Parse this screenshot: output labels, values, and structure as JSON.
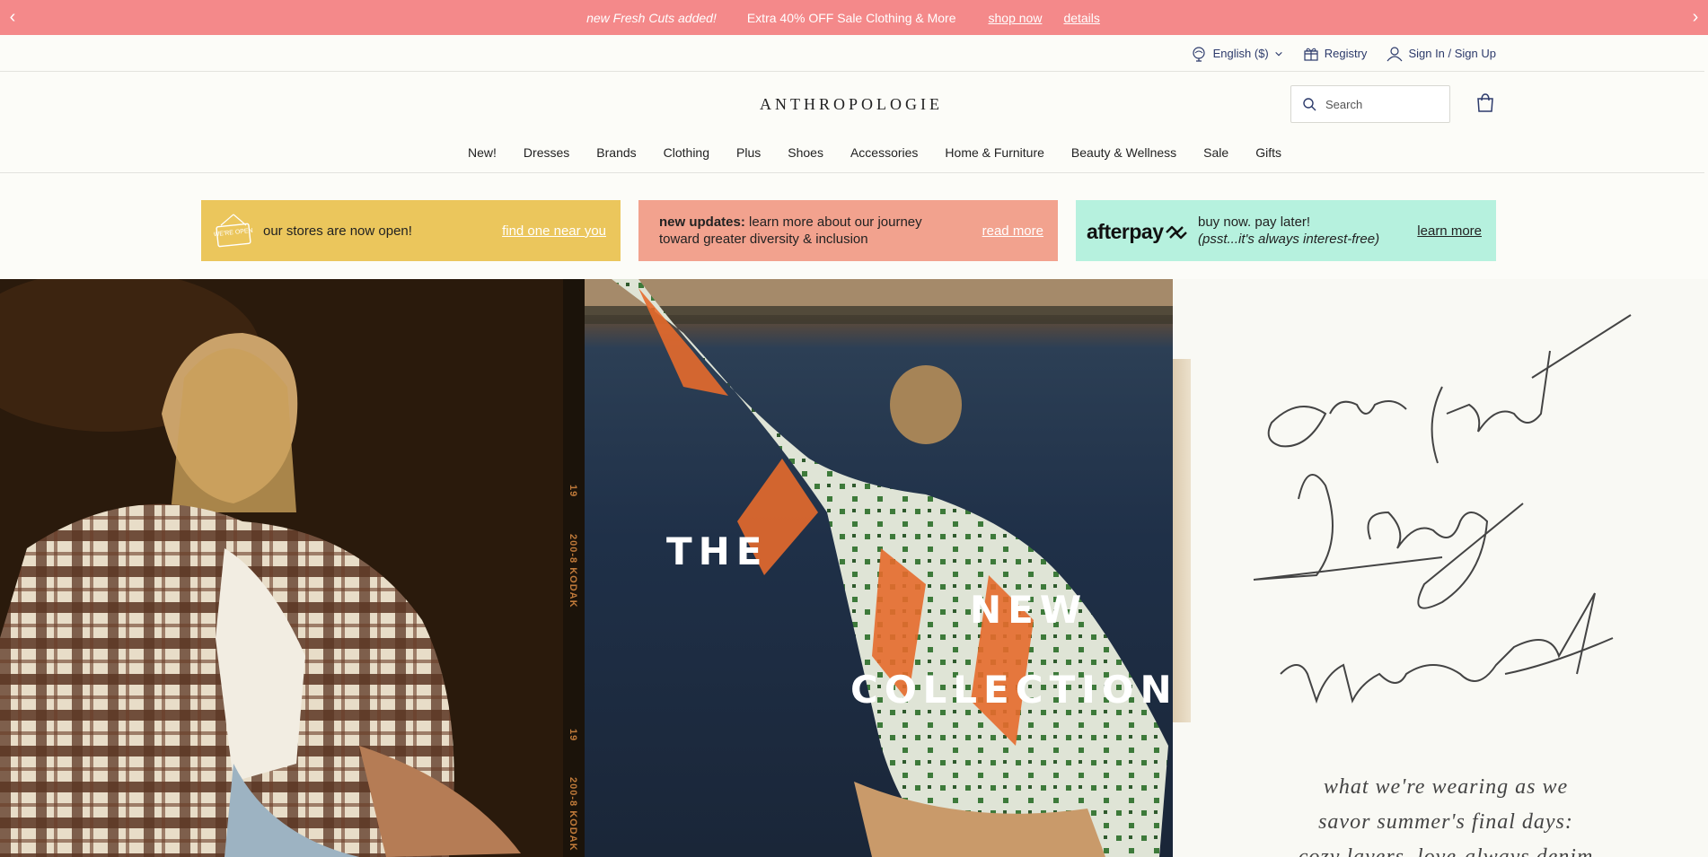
{
  "promo": {
    "left_arrow": "‹",
    "right_arrow": "›",
    "message_a": "new Fresh Cuts added!",
    "message_b": "Extra 40% OFF Sale Clothing & More",
    "shop_now": "shop now",
    "details": "details"
  },
  "utility": {
    "language": "English ($)",
    "registry": "Registry",
    "sign_in": "Sign In / Sign Up"
  },
  "header": {
    "logo": "ANTHROPOLOGIE",
    "search_placeholder": "Search"
  },
  "nav": {
    "items": [
      "New!",
      "Dresses",
      "Brands",
      "Clothing",
      "Plus",
      "Shoes",
      "Accessories",
      "Home & Furniture",
      "Beauty & Wellness",
      "Sale",
      "Gifts"
    ]
  },
  "banners": {
    "stores": {
      "text": "our stores are now open!",
      "link": "find one near you",
      "sign": "WE'RE OPEN"
    },
    "updates": {
      "bold": "new updates:",
      "text_line1": " learn more about our journey",
      "text_line2": "toward greater diversity & inclusion",
      "link": "read more"
    },
    "afterpay": {
      "logo": "afterpay",
      "line1": "buy now. pay later!",
      "line2": "(psst...it's always interest-free)",
      "link": "learn more"
    }
  },
  "hero": {
    "film_text_1": "19",
    "film_text_2": "200-8 KODAK",
    "film_text_3": "19",
    "film_text_4": "200-8 KODAK",
    "title_1": "THE",
    "title_2": "NEW",
    "title_3": "COLLECTION:",
    "script_1": "one last",
    "script_2": "long",
    "script_3": "weekend",
    "sub_1": "what we're wearing as we",
    "sub_2": "savor summer's final days:",
    "sub_3": "cozy layers, love-always denim"
  },
  "colors": {
    "promo_bg": "#f4898a",
    "banner_yellow": "#ebc65c",
    "banner_salmon": "#f2a28e",
    "banner_mint": "#b6f1de",
    "utility_text": "#2c3a6b"
  }
}
